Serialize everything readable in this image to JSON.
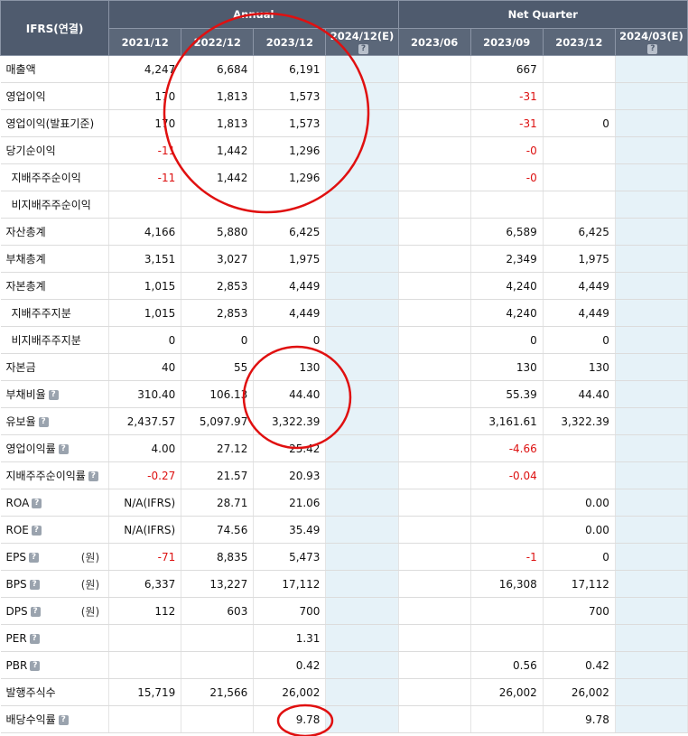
{
  "header": {
    "corner": "IFRS(연결)",
    "annual": "Annual",
    "quarter": "Net Quarter",
    "periods": [
      "2021/12",
      "2022/12",
      "2023/12",
      "2024/12(E)",
      "2023/06",
      "2023/09",
      "2023/12",
      "2024/03(E)"
    ]
  },
  "help_icon": "?",
  "rows": [
    {
      "label": "매출액",
      "indent": false,
      "help": false,
      "unit": "",
      "v": [
        "4,247",
        "6,684",
        "6,191",
        "",
        "",
        "667",
        "",
        ""
      ]
    },
    {
      "label": "영업이익",
      "indent": false,
      "help": false,
      "unit": "",
      "v": [
        "170",
        "1,813",
        "1,573",
        "",
        "",
        "-31",
        "",
        ""
      ]
    },
    {
      "label": "영업이익(발표기준)",
      "indent": false,
      "help": false,
      "unit": "",
      "v": [
        "170",
        "1,813",
        "1,573",
        "",
        "",
        "-31",
        "0",
        ""
      ]
    },
    {
      "label": "당기순이익",
      "indent": false,
      "help": false,
      "unit": "",
      "v": [
        "-11",
        "1,442",
        "1,296",
        "",
        "",
        "-0",
        "",
        ""
      ]
    },
    {
      "label": "지배주주순이익",
      "indent": true,
      "help": false,
      "unit": "",
      "v": [
        "-11",
        "1,442",
        "1,296",
        "",
        "",
        "-0",
        "",
        ""
      ]
    },
    {
      "label": "비지배주주순이익",
      "indent": true,
      "help": false,
      "unit": "",
      "v": [
        "",
        "",
        "",
        "",
        "",
        "",
        "",
        ""
      ]
    },
    {
      "label": "자산총계",
      "indent": false,
      "help": false,
      "unit": "",
      "v": [
        "4,166",
        "5,880",
        "6,425",
        "",
        "",
        "6,589",
        "6,425",
        ""
      ]
    },
    {
      "label": "부채총계",
      "indent": false,
      "help": false,
      "unit": "",
      "v": [
        "3,151",
        "3,027",
        "1,975",
        "",
        "",
        "2,349",
        "1,975",
        ""
      ]
    },
    {
      "label": "자본총계",
      "indent": false,
      "help": false,
      "unit": "",
      "v": [
        "1,015",
        "2,853",
        "4,449",
        "",
        "",
        "4,240",
        "4,449",
        ""
      ]
    },
    {
      "label": "지배주주지분",
      "indent": true,
      "help": false,
      "unit": "",
      "v": [
        "1,015",
        "2,853",
        "4,449",
        "",
        "",
        "4,240",
        "4,449",
        ""
      ]
    },
    {
      "label": "비지배주주지분",
      "indent": true,
      "help": false,
      "unit": "",
      "v": [
        "0",
        "0",
        "0",
        "",
        "",
        "0",
        "0",
        ""
      ]
    },
    {
      "label": "자본금",
      "indent": false,
      "help": false,
      "unit": "",
      "v": [
        "40",
        "55",
        "130",
        "",
        "",
        "130",
        "130",
        ""
      ]
    },
    {
      "label": "부채비율",
      "indent": false,
      "help": true,
      "unit": "",
      "v": [
        "310.40",
        "106.13",
        "44.40",
        "",
        "",
        "55.39",
        "44.40",
        ""
      ]
    },
    {
      "label": "유보율",
      "indent": false,
      "help": true,
      "unit": "",
      "v": [
        "2,437.57",
        "5,097.97",
        "3,322.39",
        "",
        "",
        "3,161.61",
        "3,322.39",
        ""
      ]
    },
    {
      "label": "영업이익률",
      "indent": false,
      "help": true,
      "unit": "",
      "v": [
        "4.00",
        "27.12",
        "25.42",
        "",
        "",
        "-4.66",
        "",
        ""
      ]
    },
    {
      "label": "지배주주순이익률",
      "indent": false,
      "help": true,
      "unit": "",
      "v": [
        "-0.27",
        "21.57",
        "20.93",
        "",
        "",
        "-0.04",
        "",
        ""
      ]
    },
    {
      "label": "ROA",
      "indent": false,
      "help": true,
      "unit": "",
      "v": [
        "N/A(IFRS)",
        "28.71",
        "21.06",
        "",
        "",
        "",
        "0.00",
        ""
      ]
    },
    {
      "label": "ROE",
      "indent": false,
      "help": true,
      "unit": "",
      "v": [
        "N/A(IFRS)",
        "74.56",
        "35.49",
        "",
        "",
        "",
        "0.00",
        ""
      ]
    },
    {
      "label": "EPS",
      "indent": false,
      "help": true,
      "unit": "(원)",
      "v": [
        "-71",
        "8,835",
        "5,473",
        "",
        "",
        "-1",
        "0",
        ""
      ]
    },
    {
      "label": "BPS",
      "indent": false,
      "help": true,
      "unit": "(원)",
      "v": [
        "6,337",
        "13,227",
        "17,112",
        "",
        "",
        "16,308",
        "17,112",
        ""
      ]
    },
    {
      "label": "DPS",
      "indent": false,
      "help": true,
      "unit": "(원)",
      "v": [
        "112",
        "603",
        "700",
        "",
        "",
        "",
        "700",
        ""
      ]
    },
    {
      "label": "PER",
      "indent": false,
      "help": true,
      "unit": "",
      "v": [
        "",
        "",
        "1.31",
        "",
        "",
        "",
        "",
        ""
      ]
    },
    {
      "label": "PBR",
      "indent": false,
      "help": true,
      "unit": "",
      "v": [
        "",
        "",
        "0.42",
        "",
        "",
        "0.56",
        "0.42",
        ""
      ]
    },
    {
      "label": "발행주식수",
      "indent": false,
      "help": false,
      "unit": "",
      "v": [
        "15,719",
        "21,566",
        "26,002",
        "",
        "",
        "26,002",
        "26,002",
        ""
      ]
    },
    {
      "label": "배당수익률",
      "indent": false,
      "help": true,
      "unit": "",
      "v": [
        "",
        "",
        "9.78",
        "",
        "",
        "",
        "9.78",
        ""
      ]
    }
  ],
  "colors": {
    "header_bg": "#4f5b6e",
    "estimate_bg": "#e6f2f8",
    "negative": "#dd1111",
    "annotation": "#e01010"
  }
}
